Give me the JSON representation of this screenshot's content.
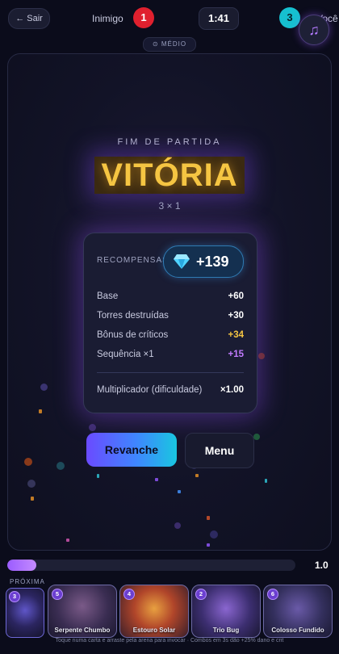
{
  "topbar": {
    "exit_label": "← Sair",
    "enemy_label": "Inimigo",
    "enemy_score": "1",
    "timer": "1:41",
    "player_score": "3",
    "player_label": "Você"
  },
  "difficulty": "⊙ MÉDIO",
  "result": {
    "heading": "FIM DE PARTIDA",
    "title": "VITÓRIA",
    "score": "3 × 1"
  },
  "rewards": {
    "label": "RECOMPENSAS",
    "total": "+139",
    "rows": [
      {
        "label": "Base",
        "value": "+60",
        "color": "#ffffff"
      },
      {
        "label": "Torres destruídas",
        "value": "+30",
        "color": "#ffffff"
      },
      {
        "label": "Bônus de críticos",
        "value": "+34",
        "color": "#f5c542"
      },
      {
        "label": "Sequência ×1",
        "value": "+15",
        "color": "#c27bff"
      }
    ],
    "multiplier_label": "Multiplicador (dificuldade)",
    "multiplier_value": "×1.00"
  },
  "actions": {
    "rematch": "Revanche",
    "menu": "Menu"
  },
  "energy": {
    "value": "1.0",
    "fraction": 0.1
  },
  "deck": {
    "next_label": "PRÓXIMA",
    "next_cost": "3",
    "cards": [
      {
        "name": "Serpente Chumbo",
        "cost": "5"
      },
      {
        "name": "Estouro Solar",
        "cost": "4"
      },
      {
        "name": "Trio Bug",
        "cost": "2"
      },
      {
        "name": "Colosso Fundido",
        "cost": "6"
      }
    ]
  },
  "hint": "Toque numa carta e arraste pela arena para invocar · Combos em 3s dão +25% dano e crit",
  "icons": {
    "music": "music-note-icon",
    "gem": "diamond-icon"
  },
  "colors": {
    "accent_purple": "#9b5cff",
    "victory_gold": "#f5c542",
    "enemy_red": "#e0202e",
    "player_cyan": "#16c0d0"
  }
}
